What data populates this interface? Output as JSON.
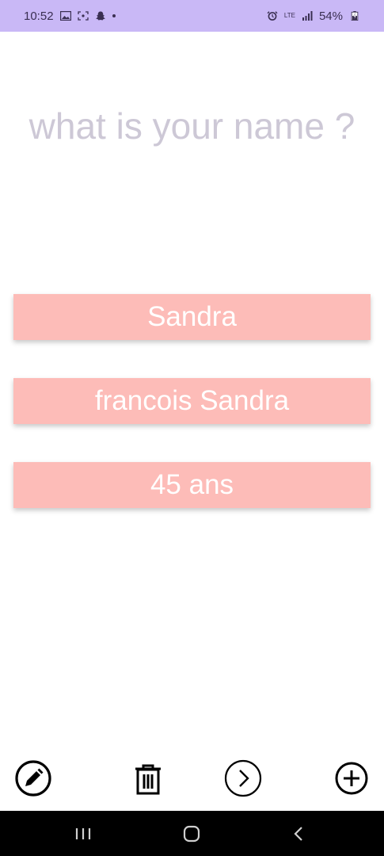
{
  "status_bar": {
    "time": "10:52",
    "network": "LTE",
    "battery": "54%",
    "background_color": "#c9b8f6"
  },
  "question": {
    "text": "what is your name ?"
  },
  "answers": [
    {
      "label": "Sandra"
    },
    {
      "label": "francois Sandra"
    },
    {
      "label": "45 ans"
    }
  ],
  "toolbar": {
    "icons": [
      "edit-icon",
      "trash-icon",
      "next-arrow-icon",
      "add-icon"
    ]
  },
  "nav_bar": {
    "icons": [
      "recents-icon",
      "home-icon",
      "back-icon"
    ]
  },
  "colors": {
    "answer_background": "#fdbcb8",
    "question_text": "#cdc8d6"
  }
}
